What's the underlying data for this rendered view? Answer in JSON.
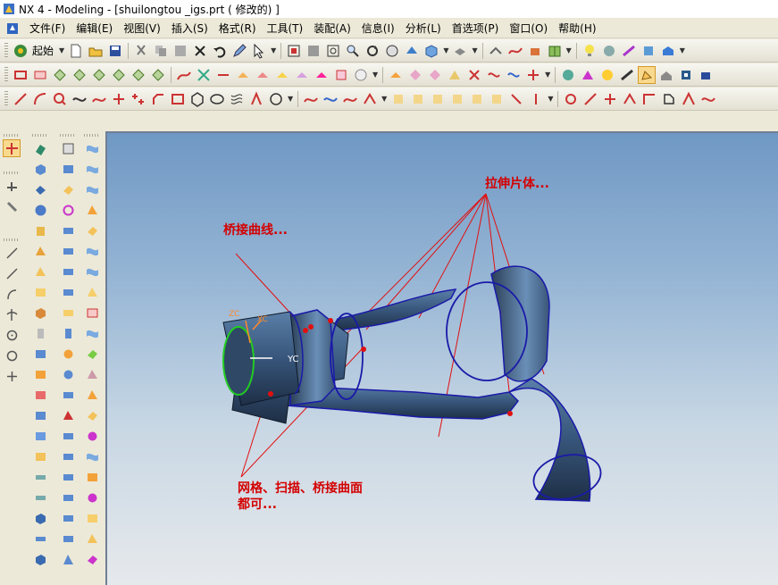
{
  "window": {
    "title": "NX 4 - Modeling - [shuilongtou _igs.prt ( 修改的) ]"
  },
  "menu": {
    "items": [
      "文件(F)",
      "编辑(E)",
      "视图(V)",
      "插入(S)",
      "格式(R)",
      "工具(T)",
      "装配(A)",
      "信息(I)",
      "分析(L)",
      "首选项(P)",
      "窗口(O)",
      "帮助(H)"
    ]
  },
  "toolbar": {
    "start_label": "起始"
  },
  "viewport": {
    "axis_labels": {
      "zc": "ZC",
      "xc": "XC",
      "yc": "YC"
    },
    "annotations": {
      "extrude_sheet": "拉伸片体...",
      "bridge_curve": "桥接曲线...",
      "surface_line1": "网格、扫描、桥接曲面",
      "surface_line2": "都可..."
    }
  },
  "colors": {
    "annotation": "#d40000",
    "edge": "#1a1aa8",
    "active_icon": "#f9d98e",
    "leader": "#e01010"
  }
}
